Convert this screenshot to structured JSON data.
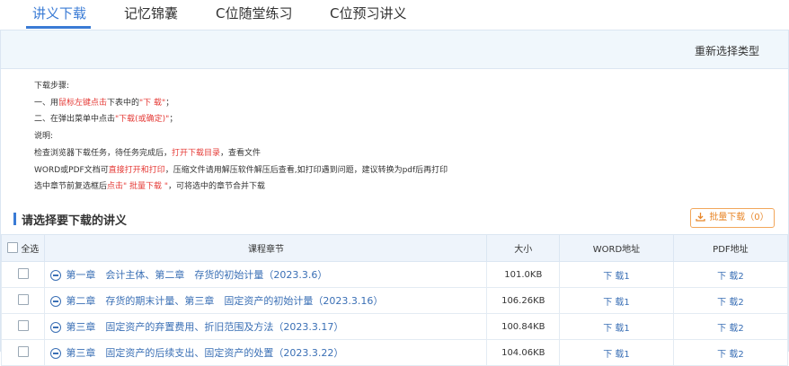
{
  "tabs": [
    {
      "label": "讲义下载",
      "active": true
    },
    {
      "label": "记忆锦囊"
    },
    {
      "label": "C位随堂练习"
    },
    {
      "label": "C位预习讲义"
    }
  ],
  "reselect_label": "重新选择类型",
  "steps": {
    "title": "下载步骤:",
    "s1_a": "一、用",
    "s1_b": "鼠标左键点击",
    "s1_c": "下表中的",
    "s1_d": "\"下 载\"",
    "s1_e": "；",
    "s2_a": "二、在弹出菜单中点击",
    "s2_b": "\"下载(或确定)\"",
    "s2_c": "；",
    "note_title": "说明:",
    "n1_a": "检查浏览器下载任务，待任务完成后，",
    "n1_b": "打开下载目录",
    "n1_c": "，查看文件",
    "n2_a": "WORD或PDF文档可",
    "n2_b": "直接打开和打印",
    "n2_c": "，压缩文件请用解压软件解压后查看,如打印遇到问题，建议转换为pdf后再打印",
    "n3_a": "选中章节前复选框后",
    "n3_b": "点击\" 批量下载 \"",
    "n3_c": "，可将选中的章节合并下载"
  },
  "section_title": "请选择要下载的讲义",
  "batch_button": "批量下载（0）",
  "table": {
    "headers": {
      "select_all": "全选",
      "chapter": "课程章节",
      "size": "大小",
      "word": "WORD地址",
      "pdf": "PDF地址"
    },
    "rows": [
      {
        "chapter": "第一章　会计主体、第二章　存货的初始计量（2023.3.6）",
        "size": "101.0KB",
        "word": "下 载1",
        "pdf": "下 载2"
      },
      {
        "chapter": "第二章　存货的期末计量、第三章　固定资产的初始计量（2023.3.16）",
        "size": "106.26KB",
        "word": "下 载1",
        "pdf": "下 载2"
      },
      {
        "chapter": "第三章　固定资产的弃置费用、折旧范围及方法（2023.3.17）",
        "size": "100.84KB",
        "word": "下 载1",
        "pdf": "下 载2"
      },
      {
        "chapter": "第三章　固定资产的后续支出、固定资产的处置（2023.3.22）",
        "size": "104.06KB",
        "word": "下 载1",
        "pdf": "下 载2"
      }
    ]
  },
  "colors": {
    "accent": "#3a7bd5",
    "warning": "#e53935",
    "orange": "#e8872a"
  }
}
